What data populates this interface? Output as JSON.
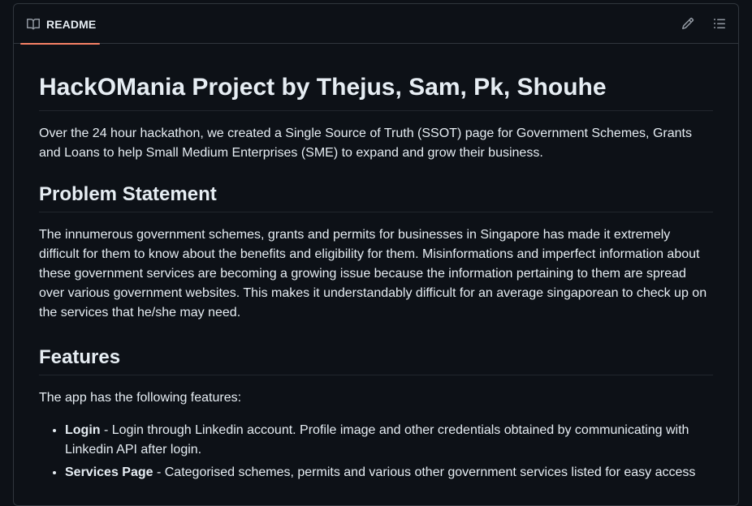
{
  "header": {
    "tab_label": "README",
    "tab_icon": "book-icon",
    "edit_icon": "pencil-icon",
    "toc_icon": "list-icon",
    "accent_color": "#f78166"
  },
  "content": {
    "title": "HackOMania Project by Thejus, Sam, Pk, Shouhe",
    "intro": "Over the 24 hour hackathon, we created a Single Source of Truth (SSOT) page for Government Schemes, Grants and Loans to help Small Medium Enterprises (SME) to expand and grow their business.",
    "problem_heading": "Problem Statement",
    "problem_text": "The innumerous government schemes, grants and permits for businesses in Singapore has made it extremely difficult for them to know about the benefits and eligibility for them. Misinformations and imperfect information about these government services are becoming a growing issue because the information pertaining to them are spread over various government websites. This makes it understandably difficult for an average singaporean to check up on the services that he/she may need.",
    "features_heading": "Features",
    "features_intro": "The app has the following features:",
    "features": [
      {
        "name": "Login",
        "desc": " - Login through Linkedin account. Profile image and other credentials obtained by communicating with Linkedin API after login."
      },
      {
        "name": "Services Page",
        "desc": " - Categorised schemes, permits and various other government services listed for easy access"
      }
    ]
  }
}
